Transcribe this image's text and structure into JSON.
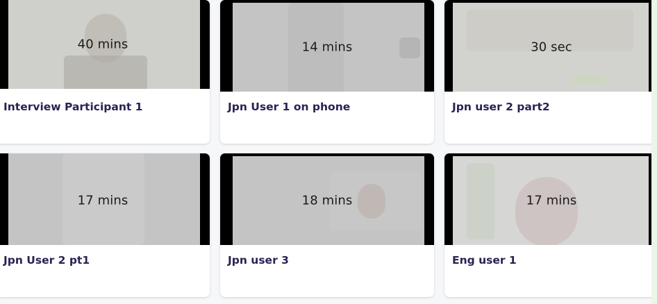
{
  "recordings": [
    {
      "duration": "40 mins",
      "title": "Interview Participant 1"
    },
    {
      "duration": "14 mins",
      "title": "Jpn User 1 on phone"
    },
    {
      "duration": "30 sec",
      "title": "Jpn user 2 part2"
    },
    {
      "duration": "17 mins",
      "title": "Jpn User 2 pt1"
    },
    {
      "duration": "18 mins",
      "title": "Jpn user 3"
    },
    {
      "duration": "17 mins",
      "title": "Eng user 1"
    }
  ]
}
